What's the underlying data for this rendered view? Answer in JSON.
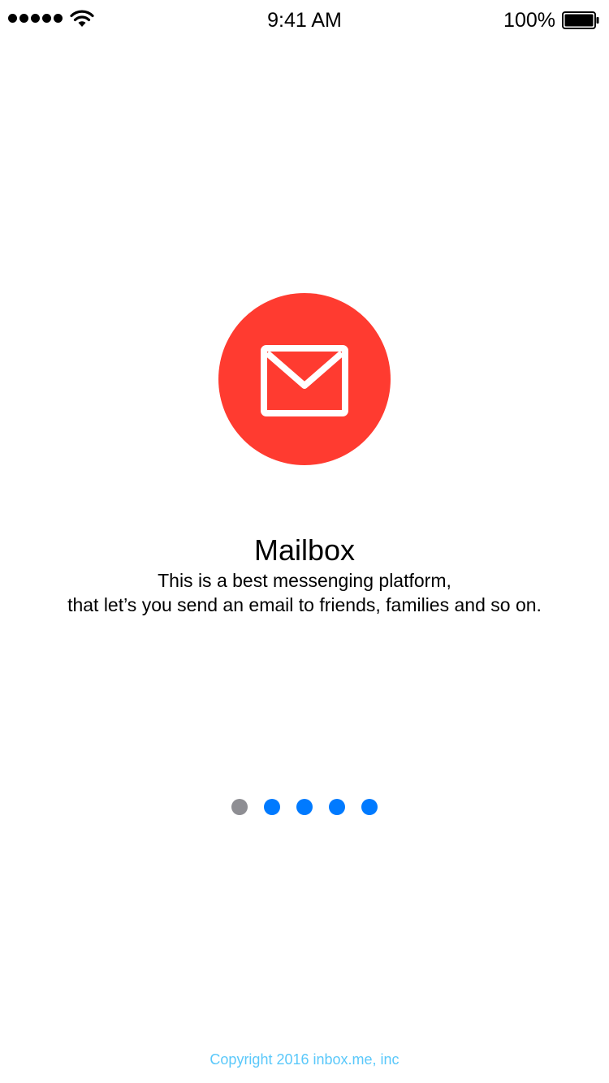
{
  "status_bar": {
    "time": "9:41 AM",
    "battery_percent": "100%",
    "signal_icon": "signal-dots-icon",
    "wifi_icon": "wifi-icon",
    "battery_icon": "battery-full-icon"
  },
  "onboarding": {
    "logo_icon": "mail-envelope-icon",
    "title": "Mailbox",
    "description_line1": "This is a best messenging platform,",
    "description_line2": "that let’s you send an email to friends, families and so on.",
    "pages_total": 5,
    "current_page": 1
  },
  "footer": {
    "copyright": "Copyright 2016 inbox.me, inc"
  },
  "colors": {
    "logo_background": "#ff3b30",
    "page_dot": "#007aff",
    "page_dot_active": "#8e8e93",
    "copyright_text": "#5ac8fa"
  }
}
